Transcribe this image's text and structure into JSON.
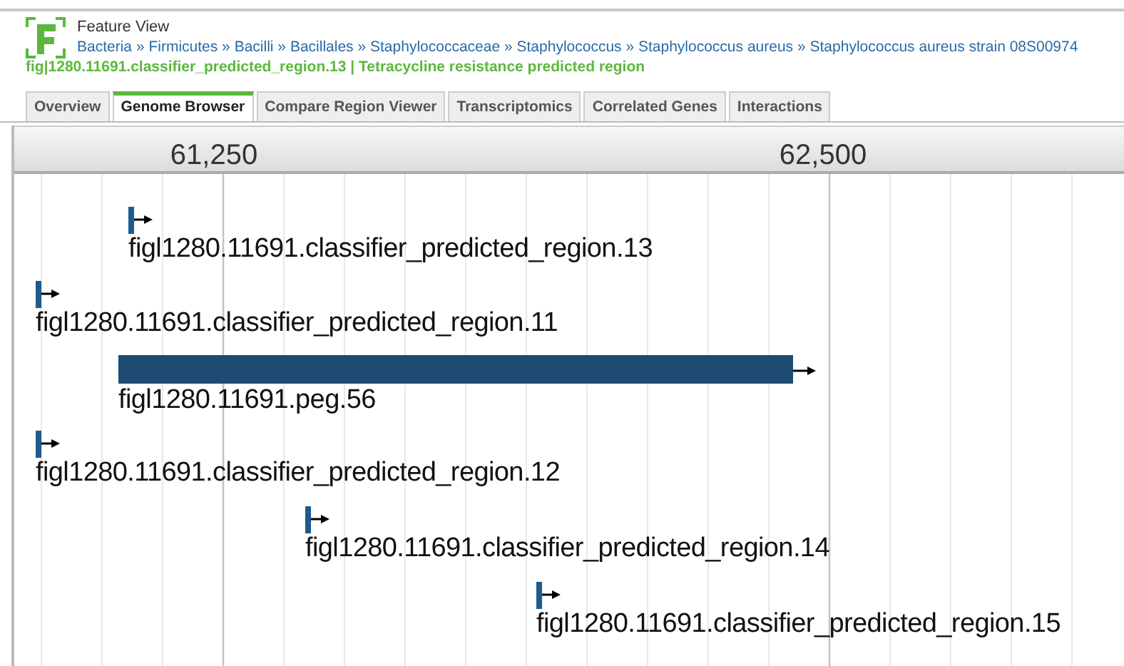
{
  "header": {
    "view_title": "Feature View",
    "breadcrumb": [
      "Bacteria",
      "Firmicutes",
      "Bacilli",
      "Bacillales",
      "Staphylococcaceae",
      "Staphylococcus",
      "Staphylococcus aureus",
      "Staphylococcus aureus strain 08S00974"
    ],
    "separator": "»",
    "feature_title": "fig|1280.11691.classifier_predicted_region.13 | Tetracycline resistance predicted region"
  },
  "tabs": [
    {
      "label": "Overview",
      "selected": false
    },
    {
      "label": "Genome Browser",
      "selected": true
    },
    {
      "label": "Compare Region Viewer",
      "selected": false
    },
    {
      "label": "Transcriptomics",
      "selected": false
    },
    {
      "label": "Correlated Genes",
      "selected": false
    },
    {
      "label": "Interactions",
      "selected": false
    }
  ],
  "ruler": {
    "ticks": [
      "61,250",
      "62,500"
    ]
  },
  "features": [
    {
      "label": "figl1280.11691.classifier_predicted_region.13",
      "kind": "marker"
    },
    {
      "label": "figl1280.11691.classifier_predicted_region.11",
      "kind": "marker"
    },
    {
      "label": "figl1280.11691.peg.56",
      "kind": "gene"
    },
    {
      "label": "figl1280.11691.classifier_predicted_region.12",
      "kind": "marker"
    },
    {
      "label": "figl1280.11691.classifier_predicted_region.14",
      "kind": "marker"
    },
    {
      "label": "figl1280.11691.classifier_predicted_region.15",
      "kind": "marker"
    }
  ]
}
